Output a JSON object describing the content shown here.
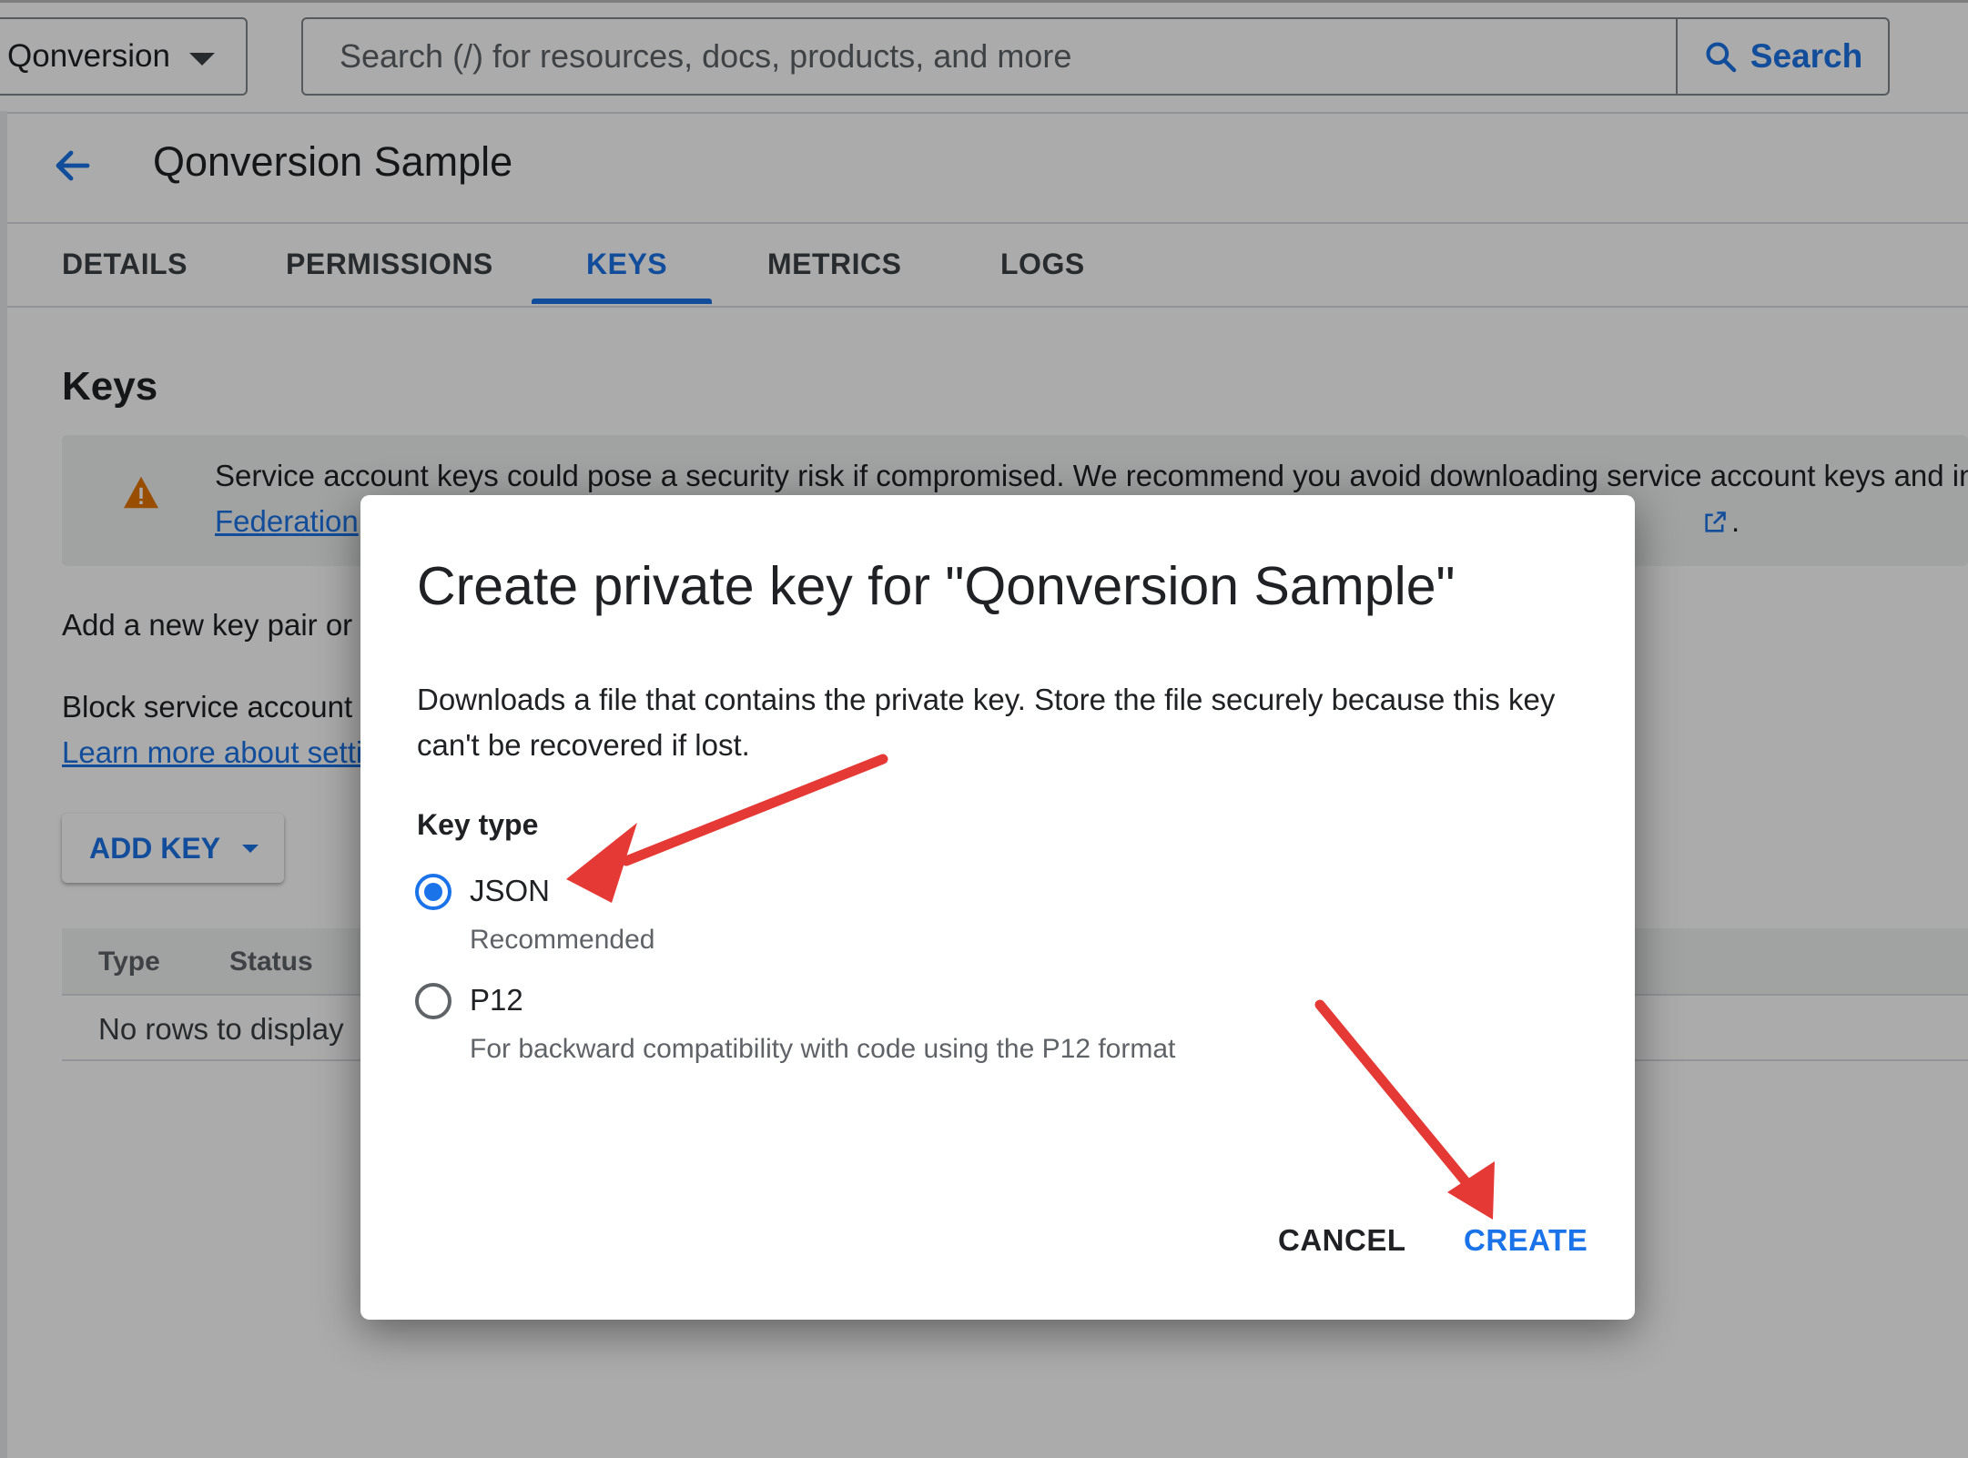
{
  "topbar": {
    "project_name": "Qonversion",
    "search_placeholder": "Search (/) for resources, docs, products, and more",
    "search_button": "Search"
  },
  "page": {
    "title": "Qonversion Sample",
    "tabs": [
      {
        "label": "DETAILS"
      },
      {
        "label": "PERMISSIONS"
      },
      {
        "label": "KEYS",
        "active": true
      },
      {
        "label": "METRICS"
      },
      {
        "label": "LOGS"
      }
    ],
    "section_title": "Keys",
    "banner_text": "Service account keys could pose a security risk if compromised. We recommend you avoid downloading service account keys and inst",
    "banner_link": "Federation",
    "banner_period": ".",
    "add_pair_text": "Add a new key pair or u",
    "block_text": "Block service account l",
    "learn_more": "Learn more about setti",
    "add_key_button": "ADD KEY",
    "table": {
      "columns": [
        "Type",
        "Status"
      ],
      "empty_message": "No rows to display"
    }
  },
  "dialog": {
    "title": "Create private key for \"Qonversion Sample\"",
    "description": "Downloads a file that contains the private key. Store the file securely because this key can't be recovered if lost.",
    "key_type_label": "Key type",
    "options": [
      {
        "label": "JSON",
        "description": "Recommended",
        "selected": true
      },
      {
        "label": "P12",
        "description": "For backward compatibility with code using the P12 format",
        "selected": false
      }
    ],
    "cancel_button": "CANCEL",
    "create_button": "CREATE"
  },
  "colors": {
    "accent": "#1a73e8",
    "warning": "#e37400",
    "annotation_arrow": "#e53935"
  },
  "icons": [
    "chevron-down-icon",
    "search-icon",
    "back-arrow-icon",
    "warning-icon",
    "external-link-icon"
  ]
}
